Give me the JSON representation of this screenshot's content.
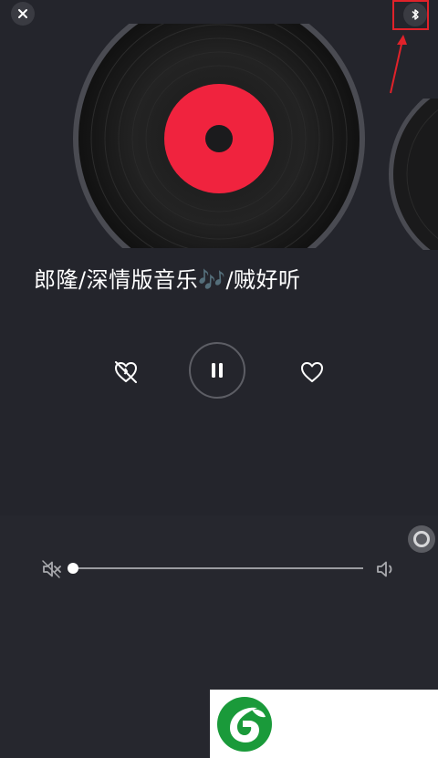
{
  "header": {
    "close_icon": "close-icon",
    "bluetooth_icon": "bluetooth-icon",
    "highlight_color": "#e0222a"
  },
  "player": {
    "song_title": "郎隆/深情版音乐🎶/贼好听",
    "disc_label_color": "#f0233e",
    "dislike_icon": "heart-off-icon",
    "pause_icon": "pause-icon",
    "like_icon": "heart-icon"
  },
  "volume": {
    "mute_icon": "mute-icon",
    "volume_icon": "volume-icon",
    "level": 0
  },
  "overlay": {
    "assistive_icon": "assistive-touch-icon",
    "logo": "leaf-logo",
    "logo_color": "#1a9a3a"
  }
}
